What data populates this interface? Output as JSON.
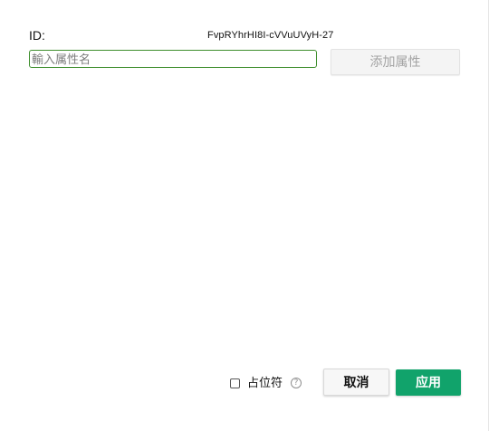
{
  "dialog": {
    "id_label": "ID:",
    "id_value": "FvpRYhrHI8I-cVVuUVyH-27",
    "attribute_input": {
      "value": "",
      "placeholder": "輸入属性名"
    },
    "add_attribute_label": "添加属性",
    "placeholder_checkbox": {
      "checked": false,
      "label": "占位符"
    },
    "help_icon": "question-circle-icon",
    "cancel_label": "取消",
    "apply_label": "应用"
  },
  "colors": {
    "input_focus_border": "#3e8e2d",
    "apply_button_bg": "#11a36b",
    "disabled_text": "#a3a3a3"
  }
}
